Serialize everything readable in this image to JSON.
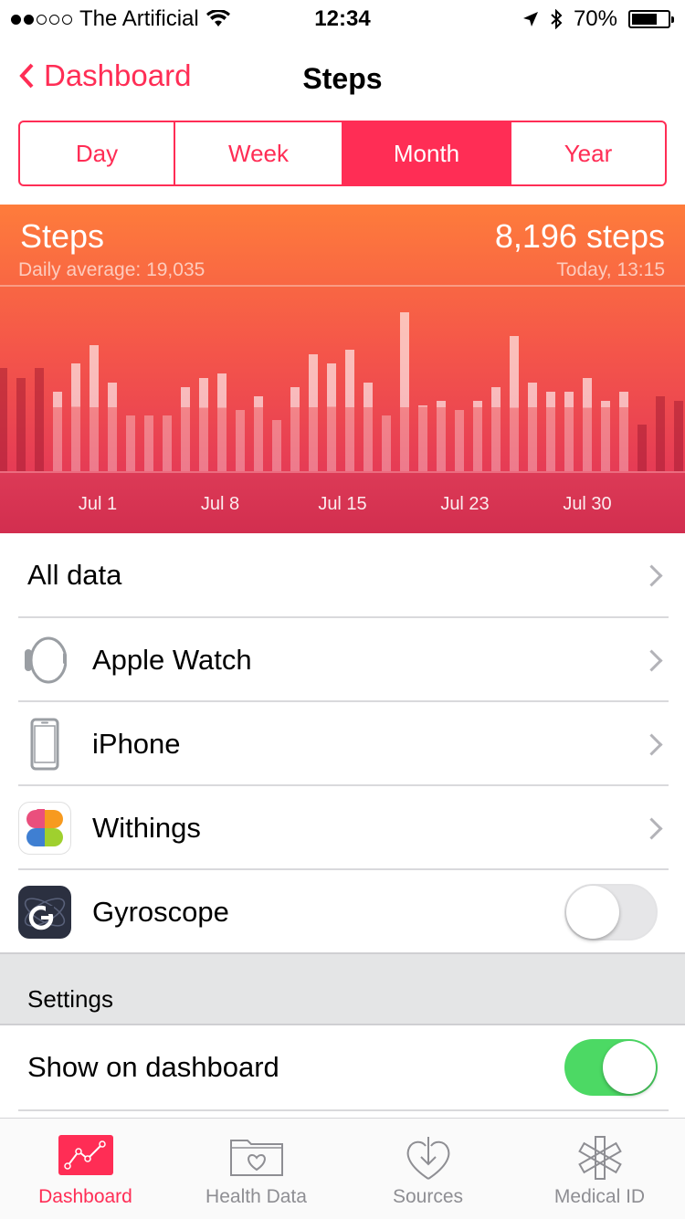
{
  "status": {
    "carrier": "The Artificial",
    "time": "12:34",
    "battery": "70%",
    "battery_level": 0.7
  },
  "nav": {
    "back_label": "Dashboard",
    "title": "Steps"
  },
  "segments": [
    {
      "label": "Day",
      "active": false
    },
    {
      "label": "Week",
      "active": false
    },
    {
      "label": "Month",
      "active": true
    },
    {
      "label": "Year",
      "active": false
    }
  ],
  "chart_data": {
    "type": "bar",
    "title": "Steps",
    "subtitle": "Daily average: 19,035",
    "current_value": "8,196 steps",
    "current_time": "Today, 13:15",
    "x_tick_labels": [
      "Jul 1",
      "Jul 8",
      "Jul 15",
      "Jul 23",
      "Jul 30"
    ],
    "values": [
      22000,
      20000,
      22000,
      17000,
      23000,
      27000,
      19000,
      12000,
      12000,
      12000,
      18000,
      20000,
      21000,
      13000,
      16000,
      11000,
      18000,
      25000,
      23000,
      26000,
      19000,
      12000,
      34000,
      14000,
      15000,
      13000,
      15000,
      18000,
      29000,
      19000,
      17000,
      17000,
      20000,
      15000,
      17000,
      10000,
      16000,
      15000,
      20000
    ],
    "highlighted_range": [
      3,
      34
    ],
    "ylim": [
      0,
      34000
    ],
    "colors": {
      "top": "#fe7c3b",
      "bottom": "#d5304f",
      "bar": "#ffffff"
    }
  },
  "sources": {
    "all_data": "All data",
    "items": [
      {
        "label": "Apple Watch",
        "icon": "apple-watch-icon",
        "control": "chevron"
      },
      {
        "label": "iPhone",
        "icon": "iphone-icon",
        "control": "chevron"
      },
      {
        "label": "Withings",
        "icon": "withings-icon",
        "control": "chevron"
      },
      {
        "label": "Gyroscope",
        "icon": "gyroscope-icon",
        "control": "toggle",
        "on": false
      }
    ]
  },
  "settings": {
    "header": "Settings",
    "show_on_dashboard": "Show on dashboard",
    "show_on_dashboard_on": true
  },
  "tabbar": [
    {
      "label": "Dashboard",
      "icon": "dashboard-icon",
      "active": true
    },
    {
      "label": "Health Data",
      "icon": "health-data-icon",
      "active": false
    },
    {
      "label": "Sources",
      "icon": "sources-icon",
      "active": false
    },
    {
      "label": "Medical ID",
      "icon": "medical-id-icon",
      "active": false
    }
  ],
  "accent": "#ff2d55",
  "toggle_on_color": "#4cd964"
}
